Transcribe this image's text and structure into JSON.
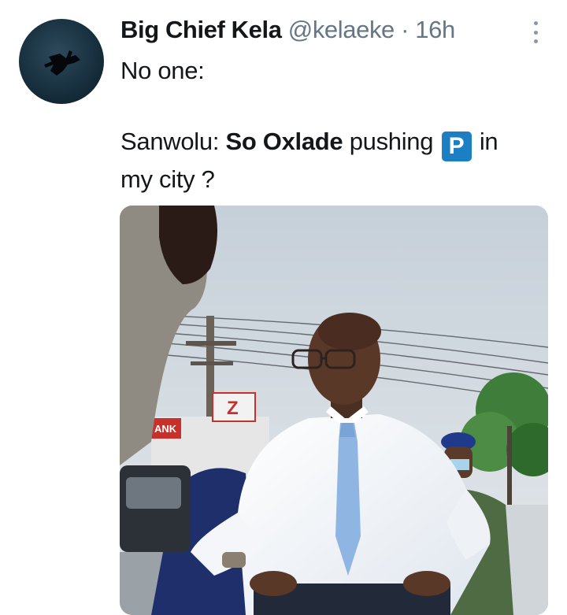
{
  "tweet": {
    "author_name": "Big Chief Kela",
    "author_handle": "@kelaeke",
    "separator": "·",
    "time": "16h",
    "text": {
      "line1": "No one:",
      "line2_prefix": "Sanwolu: ",
      "line2_bold": "So Oxlade",
      "line2_middle": " pushing ",
      "badge_label": "P",
      "line2_suffix": " in",
      "line3": "my city ?"
    },
    "image": {
      "signs": [
        "ANK",
        "Z"
      ]
    }
  },
  "icons": {
    "menu": "more-vertical-icon",
    "avatar": "avatar-image"
  },
  "colors": {
    "name": "#14171a",
    "handle": "#657786",
    "badge": "#1c7fc4",
    "menu_dots": "#8899a6"
  }
}
